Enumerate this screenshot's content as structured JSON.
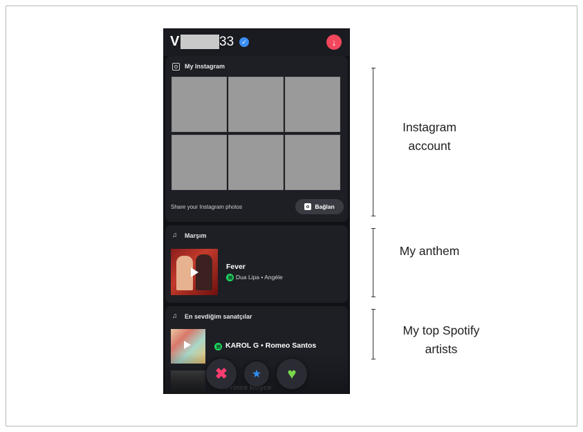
{
  "profile": {
    "name": "V",
    "age": "33",
    "verified_icon": "check-badge-icon"
  },
  "instagram": {
    "title": "My Instagram",
    "share_text": "Share your Instagram photos",
    "connect_label": "Bağlan",
    "photo_count": 6
  },
  "anthem": {
    "title": "Marşım",
    "song": "Fever",
    "artists": "Dua Lipa  •  Angèle"
  },
  "top_artists": {
    "title": "En sevdiğim sanatçılar",
    "line1": "KAROL G  •  Romeo Santos",
    "line2": "Prince Royce"
  },
  "actions": {
    "nope": "✖",
    "super_like": "★",
    "like": "♥"
  },
  "annotations": {
    "instagram_l1": "Instagram",
    "instagram_l2": "account",
    "anthem": "My anthem",
    "spotify_l1": "My top Spotify",
    "spotify_l2": "artists"
  },
  "colors": {
    "background": "#111216",
    "card": "#1e1f25",
    "accent_red": "#f2475d",
    "spotify_green": "#1ed760",
    "verified_blue": "#3b8df6"
  }
}
